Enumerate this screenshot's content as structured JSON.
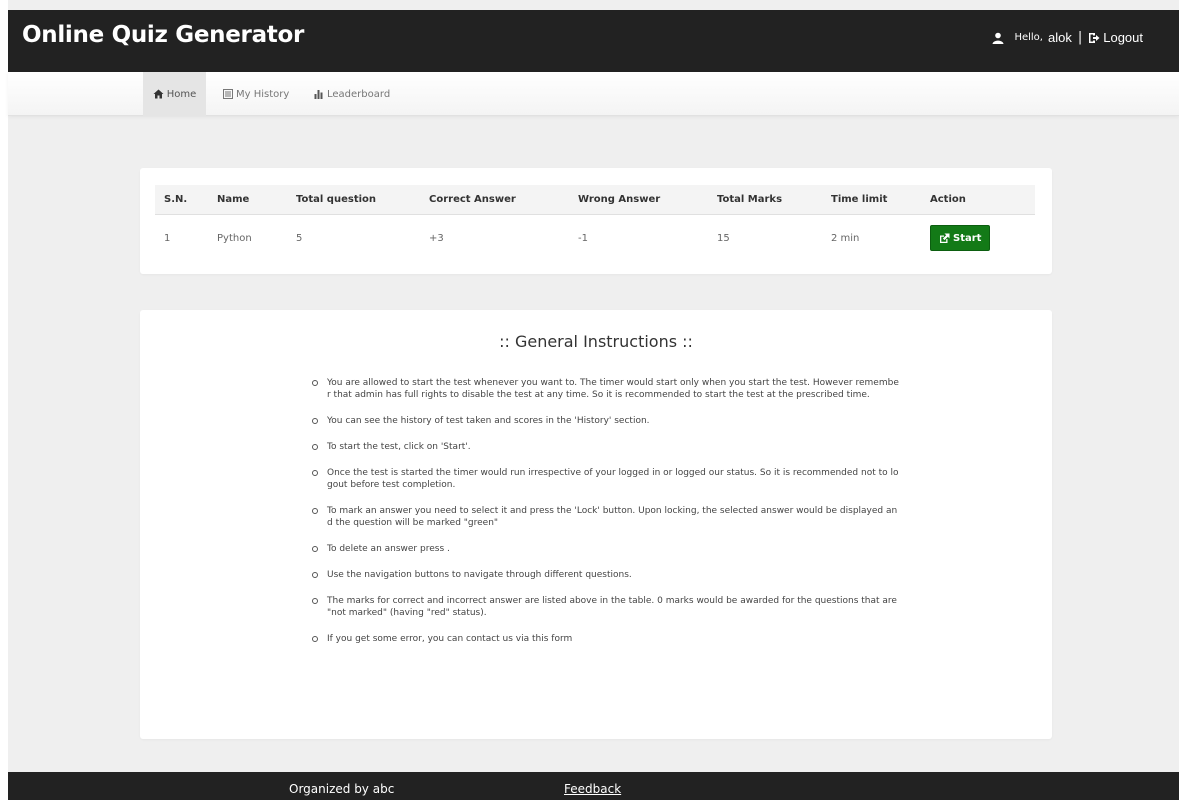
{
  "header": {
    "brand": "Online Quiz Generator",
    "hello": "Hello,",
    "username": "alok",
    "separator": "|",
    "logout_label": "Logout"
  },
  "nav": {
    "items": [
      {
        "label": "Home",
        "icon": "home-icon",
        "active": true
      },
      {
        "label": "My History",
        "icon": "list-icon",
        "active": false
      },
      {
        "label": "Leaderboard",
        "icon": "bar-chart-icon",
        "active": false
      }
    ]
  },
  "quiz_table": {
    "columns": [
      "S.N.",
      "Name",
      "Total question",
      "Correct Answer",
      "Wrong Answer",
      "Total Marks",
      "Time limit",
      "Action"
    ],
    "rows": [
      {
        "sn": "1",
        "name": "Python",
        "total_question": "5",
        "correct_answer": "+3",
        "wrong_answer": "-1",
        "total_marks": "15",
        "time_limit": "2 min",
        "action_label": "Start"
      }
    ]
  },
  "instructions": {
    "title": ":: General Instructions ::",
    "items": [
      "You are allowed to start the test whenever you want to. The timer would start only when you start the test. However remember that admin has full rights to disable the test at any time. So it is recommended to start the test at the prescribed time.",
      "You can see the history of test taken and scores in the 'History' section.",
      "To start the test, click on 'Start'.",
      "Once the test is started the timer would run irrespective of your logged in or logged our status. So it is recommended not to logout before test completion.",
      "To mark an answer you need to select it and press the 'Lock' button. Upon locking, the selected answer would be displayed and the question will be marked \"green\"",
      "To delete an answer press .",
      "Use the navigation buttons to navigate through different questions.",
      "The marks for correct and incorrect answer are listed above in the table. 0 marks would be awarded for the questions that are \"not marked\" (having \"red\" status).",
      "If you get some error, you can contact us via this form"
    ]
  },
  "footer": {
    "organized": "Organized by abc",
    "feedback_label": "Feedback"
  },
  "colors": {
    "header_bg": "#222222",
    "page_bg": "#efefef",
    "start_button": "#137a17"
  }
}
